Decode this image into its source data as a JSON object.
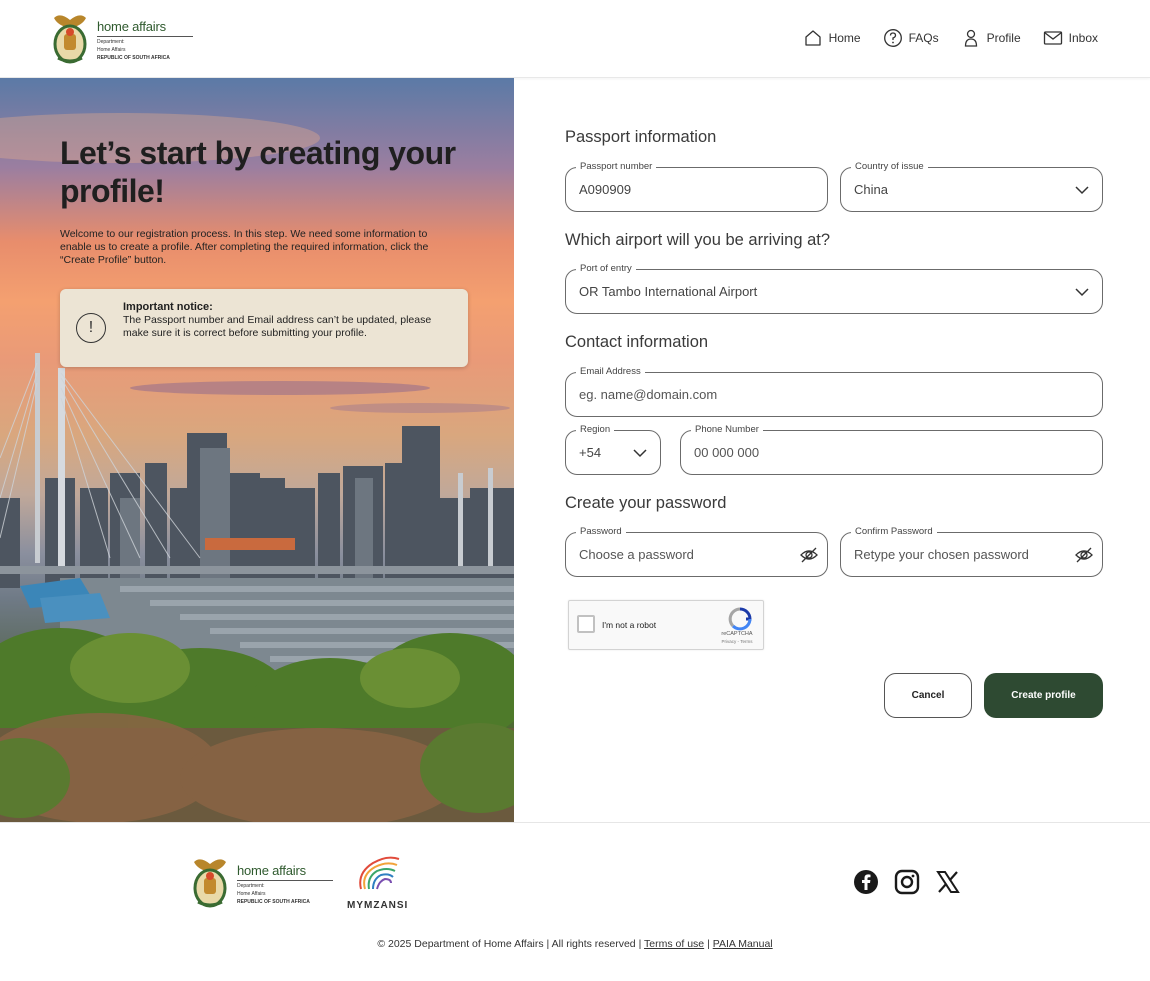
{
  "header": {
    "logo": {
      "title": "home affairs",
      "line1": "Department:",
      "line2": "Home Affairs",
      "line3": "REPUBLIC OF SOUTH AFRICA"
    },
    "nav": [
      {
        "label": "Home",
        "icon": "home-icon"
      },
      {
        "label": "FAQs",
        "icon": "question-icon"
      },
      {
        "label": "Profile",
        "icon": "user-icon"
      },
      {
        "label": "Inbox",
        "icon": "mail-icon"
      }
    ]
  },
  "hero": {
    "title": "Let’s start by creating your profile!",
    "description": "Welcome to our registration process. In this step. We need some information to enable us to create a profile. After completing the required information, click the “Create Profile” button.",
    "notice": {
      "icon": "exclamation-icon",
      "title": "Important notice:",
      "text": "The Passport number and Email address can’t be updated, please make sure it is correct before submitting your profile."
    }
  },
  "form": {
    "passport_section": "Passport information",
    "passport_number": {
      "label": "Passport number",
      "value": "A090909"
    },
    "country_of_issue": {
      "label": "Country of issue",
      "value": "China"
    },
    "airport_section": "Which airport will you be arriving at?",
    "port_of_entry": {
      "label": "Port of entry",
      "value": "OR Tambo International Airport"
    },
    "contact_section": "Contact information",
    "email": {
      "label": "Email Address",
      "placeholder": "eg. name@domain.com"
    },
    "region": {
      "label": "Region",
      "value": "+54"
    },
    "phone": {
      "label": "Phone Number",
      "placeholder": "00 000 000"
    },
    "password_section": "Create your password",
    "password": {
      "label": "Password",
      "placeholder": "Choose a password"
    },
    "confirm_password": {
      "label": "Confirm Password",
      "placeholder": "Retype your chosen password"
    },
    "captcha": {
      "label": "I'm not a robot",
      "brand": "reCAPTCHA",
      "terms": "Privacy - Terms"
    },
    "cancel_label": "Cancel",
    "create_label": "Create profile"
  },
  "footer": {
    "logo": {
      "title": "home affairs",
      "line1": "Department:",
      "line2": "Home Affairs",
      "line3": "REPUBLIC OF SOUTH AFRICA"
    },
    "mymzansi": "MYMZANSI",
    "socials": [
      "facebook-icon",
      "instagram-icon",
      "x-icon"
    ],
    "copyright": "© 2025 Department of Home Affairs | All rights reserved |",
    "terms_link": "Terms of use",
    "separator": "|",
    "paia_link": "PAIA Manual"
  },
  "colors": {
    "primary": "#2e4a32",
    "brand_green": "#2f5a2e",
    "notice_bg": "#ece4d4"
  }
}
